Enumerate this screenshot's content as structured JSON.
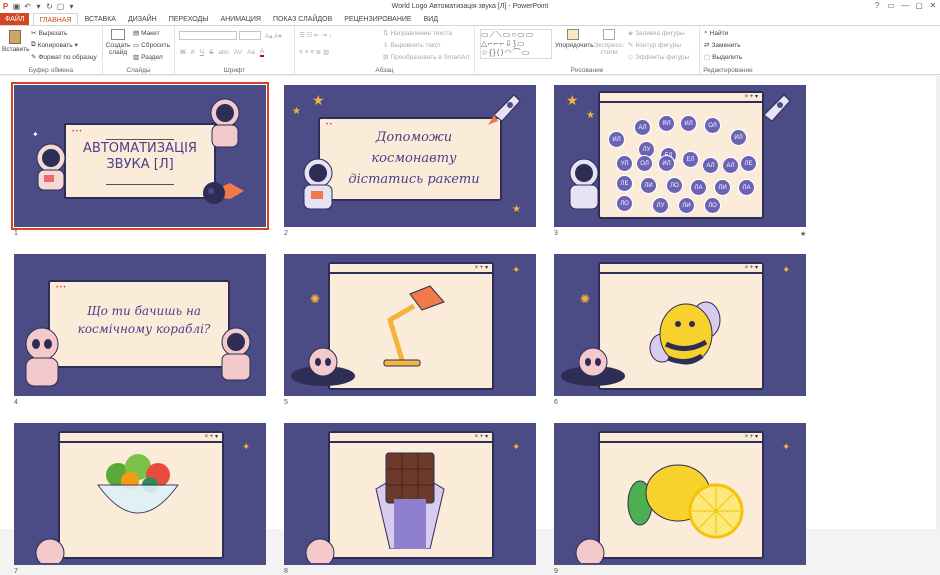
{
  "app": {
    "title": "World Logo Автоматизація звука [Л] - PowerPoint"
  },
  "quick_access": [
    "save-icon",
    "undo-icon",
    "redo-icon",
    "start-icon"
  ],
  "window_controls": [
    "?",
    "▭",
    "—",
    "▢",
    "✕"
  ],
  "tabs": [
    "ФАЙЛ",
    "ГЛАВНАЯ",
    "ВСТАВКА",
    "ДИЗАЙН",
    "ПЕРЕХОДЫ",
    "АНИМАЦИЯ",
    "ПОКАЗ СЛАЙДОВ",
    "РЕЦЕНЗИРОВАНИЕ",
    "ВИД"
  ],
  "active_tab": "ГЛАВНАЯ",
  "ribbon": {
    "clipboard": {
      "label": "Буфер обмена",
      "paste": "Вставить",
      "cut": "Вырезать",
      "copy": "Копировать",
      "format": "Формат по образцу"
    },
    "slides": {
      "label": "Слайды",
      "new_slide": "Создать",
      "new_slide2": "слайд",
      "layout": "Макет",
      "reset": "Сбросить",
      "section": "Раздел"
    },
    "font": {
      "label": "Шрифт",
      "bold": "Ж",
      "italic": "К",
      "underline": "Ч",
      "strike": "S",
      "shadow": "abc",
      "spacing": "AV",
      "case": "Aa",
      "color": "A"
    },
    "paragraph": {
      "label": "Абзац",
      "text_dir": "Направление текста",
      "align_text": "Выровнять текст",
      "smartart": "Преобразовать в SmartArt"
    },
    "drawing": {
      "label": "Рисование",
      "arrange": "Упорядочить",
      "quick_styles": "Экспресс-",
      "quick_styles2": "стили",
      "fill": "Заливка фигуры",
      "outline": "Контур фигуры",
      "effects": "Эффекты фигуры"
    },
    "editing": {
      "label": "Редактирование",
      "find": "Найти",
      "replace": "Заменить",
      "select": "Выделить"
    }
  },
  "slides": [
    {
      "num": "1",
      "title": "АВТОМАТИЗАЦІЯ ЗВУКА [Л]",
      "selected": true
    },
    {
      "num": "2",
      "title": "Допоможи космонавту дістатись ракети"
    },
    {
      "num": "3",
      "bubbles": [
        "ИЛ",
        "АЛ",
        "ЯЛ",
        "ИЛ",
        "ОЛ",
        "ИЛ",
        "ЛУ",
        "ЕЛ",
        "УЛ",
        "ОЛ",
        "ИЛ",
        "ЕЛ",
        "АЛ",
        "АЛ",
        "ЛЕ",
        "ЛЕ",
        "ЛИ",
        "ЛО",
        "ЛА",
        "ЛИ",
        "ЛА",
        "ЛО",
        "ЛУ",
        "ЛИ",
        "ЛО"
      ],
      "star_marker": "★"
    },
    {
      "num": "4",
      "title": "Що ти бачишь на космічному кораблі?"
    },
    {
      "num": "5"
    },
    {
      "num": "6"
    },
    {
      "num": "7"
    },
    {
      "num": "8"
    },
    {
      "num": "9"
    }
  ],
  "colors": {
    "accent": "#d24726",
    "slide_bg": "#4b4b85",
    "card": "#fbecd9"
  }
}
